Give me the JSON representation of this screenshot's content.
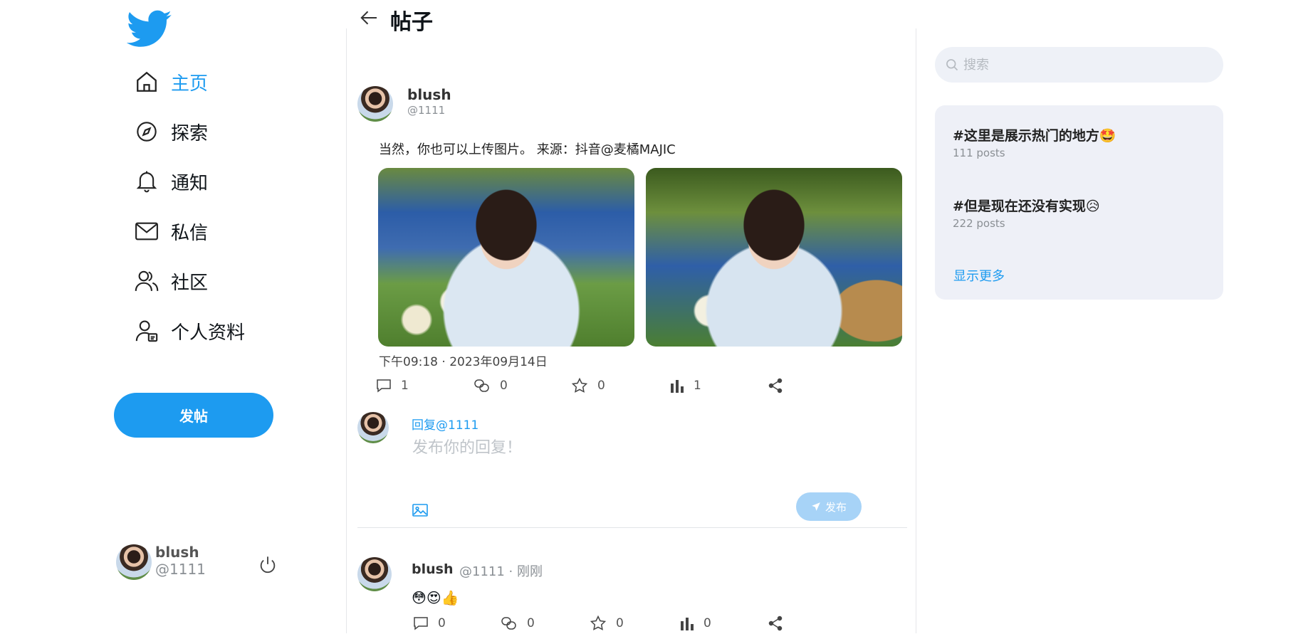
{
  "sidebar": {
    "logo_icon": "twitter-bird-icon",
    "items": [
      {
        "label": "主页",
        "icon": "home-icon",
        "active": true
      },
      {
        "label": "探索",
        "icon": "compass-icon"
      },
      {
        "label": "通知",
        "icon": "bell-icon"
      },
      {
        "label": "私信",
        "icon": "mail-icon"
      },
      {
        "label": "社区",
        "icon": "users-icon"
      },
      {
        "label": "个人资料",
        "icon": "profile-icon"
      }
    ],
    "post_button": "发帖",
    "user": {
      "name": "blush",
      "handle": "@1111"
    }
  },
  "header": {
    "title": "帖子"
  },
  "post": {
    "author": {
      "name": "blush",
      "handle": "@1111"
    },
    "text": "当然，你也可以上传图片。 来源：抖音@麦橘MAJIC",
    "timestamp": "下午09:18 · 2023年09月14日",
    "stats": {
      "replies": "1",
      "retweets": "0",
      "likes": "0",
      "views": "1"
    }
  },
  "reply_box": {
    "reply_to": "回复@1111",
    "placeholder": "发布你的回复！",
    "send_label": "发布"
  },
  "comment": {
    "name": "blush",
    "meta": "@1111 · 刚刚",
    "text": "😳😍👍",
    "stats": {
      "replies": "0",
      "retweets": "0",
      "likes": "0",
      "views": "0"
    }
  },
  "search": {
    "placeholder": "搜索"
  },
  "trends": {
    "items": [
      {
        "title": "#这里是展示热门的地方🤩",
        "posts": "111 posts"
      },
      {
        "title": "#但是现在还没有实现😥",
        "posts": "222 posts"
      }
    ],
    "show_more": "显示更多"
  },
  "colors": {
    "accent": "#1d9bf0",
    "send_disabled": "#a7d3f7",
    "card_bg": "#eef0f7"
  }
}
